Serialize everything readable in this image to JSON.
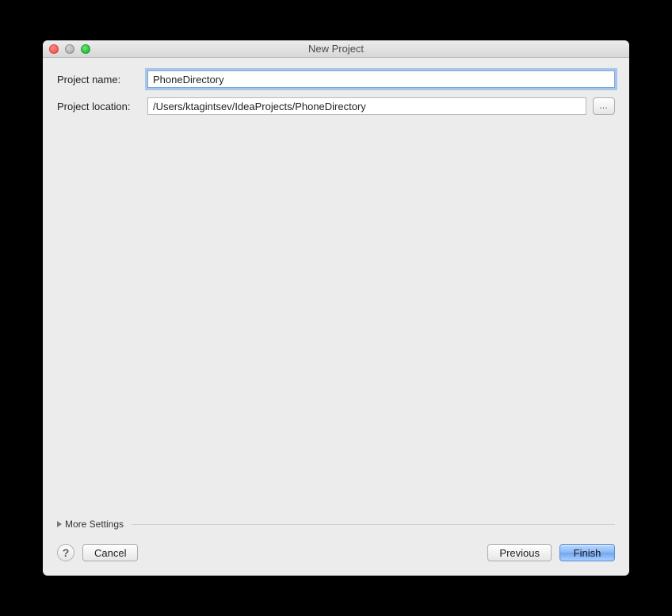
{
  "window": {
    "title": "New Project"
  },
  "form": {
    "projectName": {
      "label": "Project name:",
      "value": "PhoneDirectory"
    },
    "projectLocation": {
      "label": "Project location:",
      "value": "/Users/ktagintsev/IdeaProjects/PhoneDirectory",
      "browseLabel": "…"
    }
  },
  "moreSettings": {
    "label": "More Settings"
  },
  "buttons": {
    "help": "?",
    "cancel": "Cancel",
    "previous": "Previous",
    "finish": "Finish"
  }
}
